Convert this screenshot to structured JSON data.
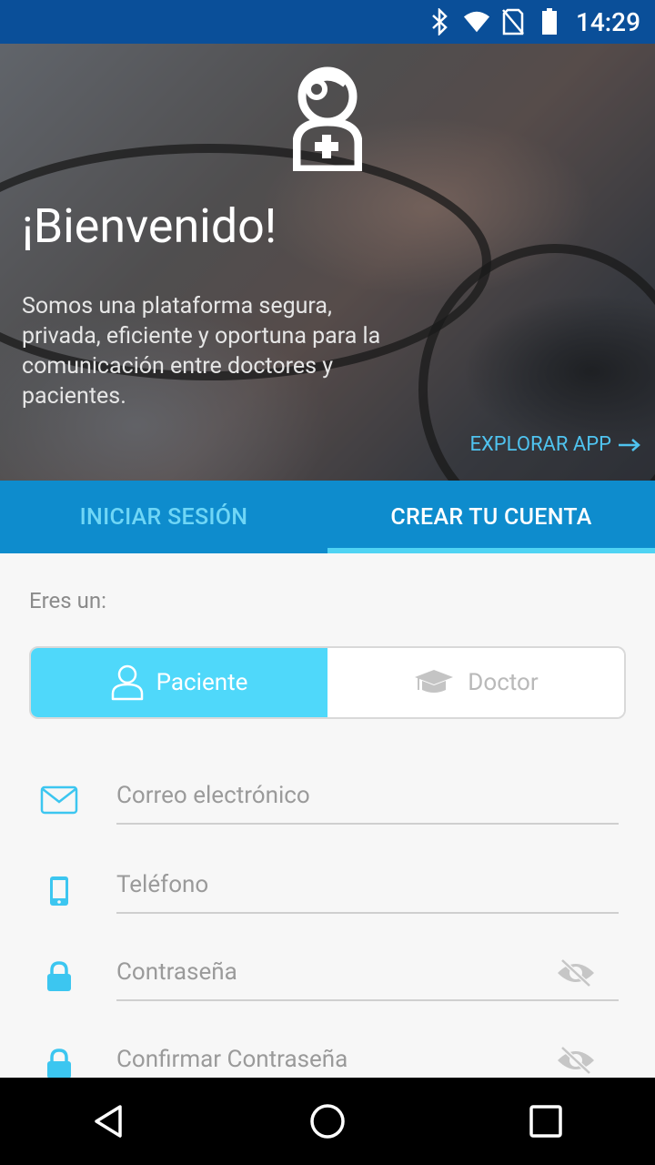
{
  "status_bar": {
    "time": "14:29",
    "icons": [
      "bluetooth-icon",
      "wifi-icon",
      "no-sim-icon",
      "battery-icon"
    ]
  },
  "hero": {
    "title": "¡Bienvenido!",
    "tagline": "Somos una plataforma segura, privada, eficiente y oportuna para la comunicación entre doctores y pacientes.",
    "explore_label": "EXPLORAR APP",
    "explore_icon": "arrow-right-icon",
    "logo_icon": "nurse-logo-icon"
  },
  "tabs": [
    {
      "label": "INICIAR SESIÓN",
      "active": false
    },
    {
      "label": "CREAR TU CUENTA",
      "active": true
    }
  ],
  "form": {
    "role_prompt": "Eres un:",
    "roles": [
      {
        "label": "Paciente",
        "icon": "user-icon",
        "selected": true
      },
      {
        "label": "Doctor",
        "icon": "graduation-cap-icon",
        "selected": false
      }
    ],
    "fields": [
      {
        "placeholder": "Correo electrónico",
        "icon": "envelope-icon",
        "value": ""
      },
      {
        "placeholder": "Teléfono",
        "icon": "phone-icon",
        "value": ""
      },
      {
        "placeholder": "Contraseña",
        "icon": "lock-icon",
        "value": "",
        "toggle_icon": "eye-slash-icon"
      },
      {
        "placeholder": "Confirmar Contraseña",
        "icon": "lock-icon",
        "value": "",
        "toggle_icon": "eye-slash-icon"
      }
    ]
  },
  "navbar": {
    "buttons": [
      "back-triangle-icon",
      "home-circle-icon",
      "recents-square-icon"
    ]
  },
  "colors": {
    "status_bar": "#0a4f99",
    "tab_bar": "#0e8ccd",
    "accent": "#4fd8fa",
    "explore_text": "#4fc3ef",
    "inactive_tab_text": "#6fd6f6"
  }
}
